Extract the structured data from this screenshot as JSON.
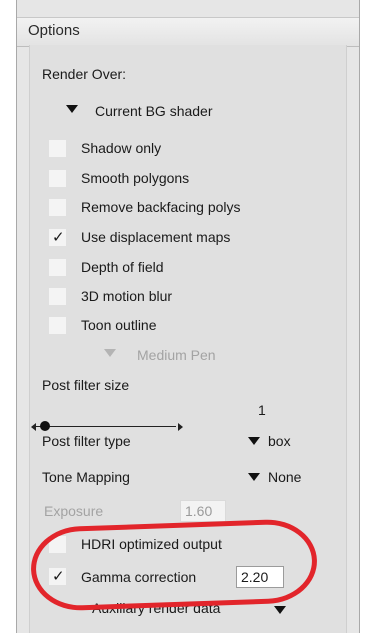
{
  "panel": {
    "title": "Options"
  },
  "render_over": {
    "label": "Render Over:",
    "selected": "Current BG shader"
  },
  "checkboxes": [
    {
      "label": "Shadow only",
      "checked": false
    },
    {
      "label": "Smooth polygons",
      "checked": false
    },
    {
      "label": "Remove backfacing polys",
      "checked": false
    },
    {
      "label": "Use displacement maps",
      "checked": true,
      "mark": "✓"
    },
    {
      "label": "Depth of field",
      "checked": false
    },
    {
      "label": "3D motion blur",
      "checked": false
    },
    {
      "label": "Toon outline",
      "checked": false
    }
  ],
  "toon_outline_style": {
    "selected": "Medium Pen",
    "enabled": false
  },
  "post_filter_size": {
    "label": "Post filter size",
    "value": "1",
    "level": 0.05
  },
  "post_filter_type": {
    "label": "Post filter type",
    "selected": "box"
  },
  "tone_mapping": {
    "label": "Tone Mapping",
    "selected": "None"
  },
  "exposure": {
    "label": "Exposure",
    "value": "1.60",
    "enabled": false
  },
  "hdri_optimized": {
    "label": "HDRI optimized output",
    "checked": false
  },
  "gamma_correction": {
    "label": "Gamma correction",
    "checked": true,
    "mark": "✓",
    "value": "2.20"
  },
  "auxiliary": {
    "label": "Auxiliary render data"
  },
  "colors": {
    "highlight": "#e2252b",
    "panel_bg": "#e0e0e0"
  }
}
